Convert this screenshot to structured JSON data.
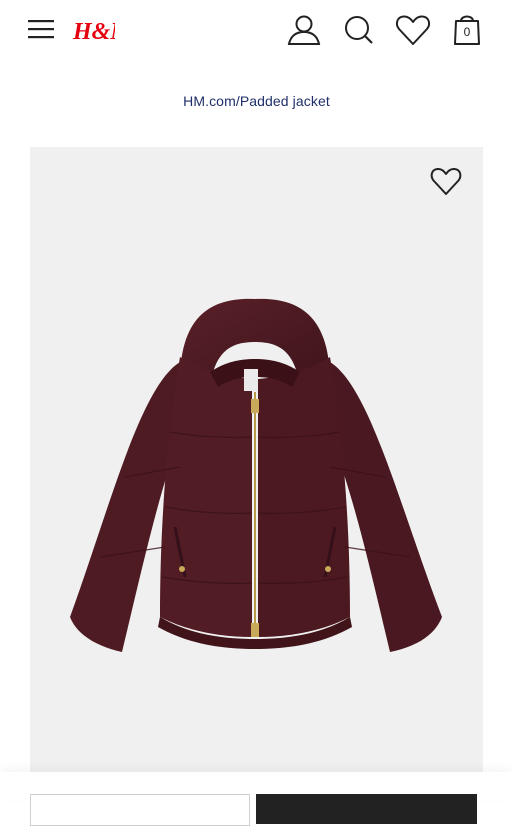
{
  "header": {
    "menu_icon": "hamburger-menu-icon",
    "logo_text": "H&M",
    "brand_color": "#e50010",
    "account_icon": "user-icon",
    "search_icon": "search-icon",
    "favourites_icon": "heart-icon",
    "bag_icon": "shopping-bag-icon",
    "bag_count": "0"
  },
  "breadcrumb": {
    "text": "HM.com/Padded jacket",
    "color": "#1f2f6a"
  },
  "product": {
    "image_icon": "padded-jacket-image",
    "jacket_color": "#4a1a22",
    "wishlist_icon": "heart-outline-icon"
  },
  "bottom_bar": {
    "add_button_color": "#222222"
  }
}
